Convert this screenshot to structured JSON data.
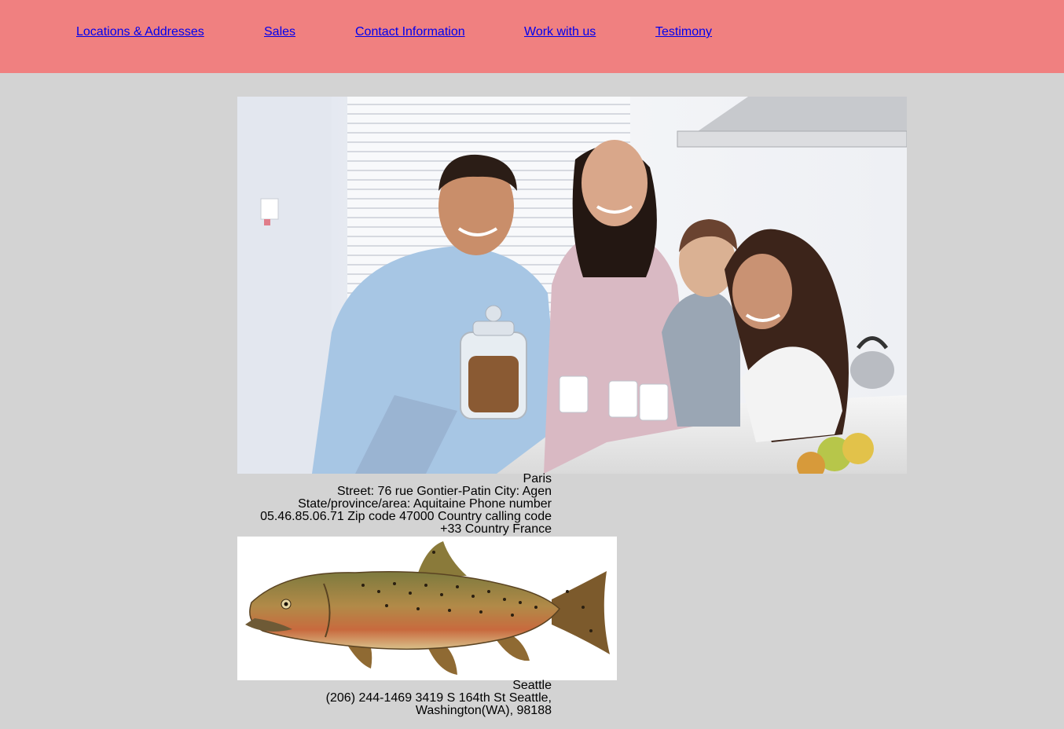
{
  "nav": {
    "items": [
      {
        "label": "Locations & Addresses"
      },
      {
        "label": "Sales"
      },
      {
        "label": "Contact Information"
      },
      {
        "label": "Work with us"
      },
      {
        "label": "Testimony"
      }
    ]
  },
  "family_photo": {
    "subject": "family-kitchen-photo"
  },
  "fish_photo": {
    "subject": "salmon-illustration"
  },
  "locations": [
    {
      "name": "Paris",
      "lines": [
        "Street: 76 rue Gontier-Patin City: Agen",
        "State/province/area: Aquitaine Phone number",
        "05.46.85.06.71 Zip code 47000 Country calling code",
        "+33 Country France"
      ]
    },
    {
      "name": "Seattle",
      "lines": [
        "(206) 244-1469 3419 S 164th St Seattle,",
        "Washington(WA), 98188"
      ]
    }
  ],
  "colors": {
    "header_bg": "#f08080",
    "page_bg": "#d3d3d3",
    "link": "#0000ee"
  }
}
